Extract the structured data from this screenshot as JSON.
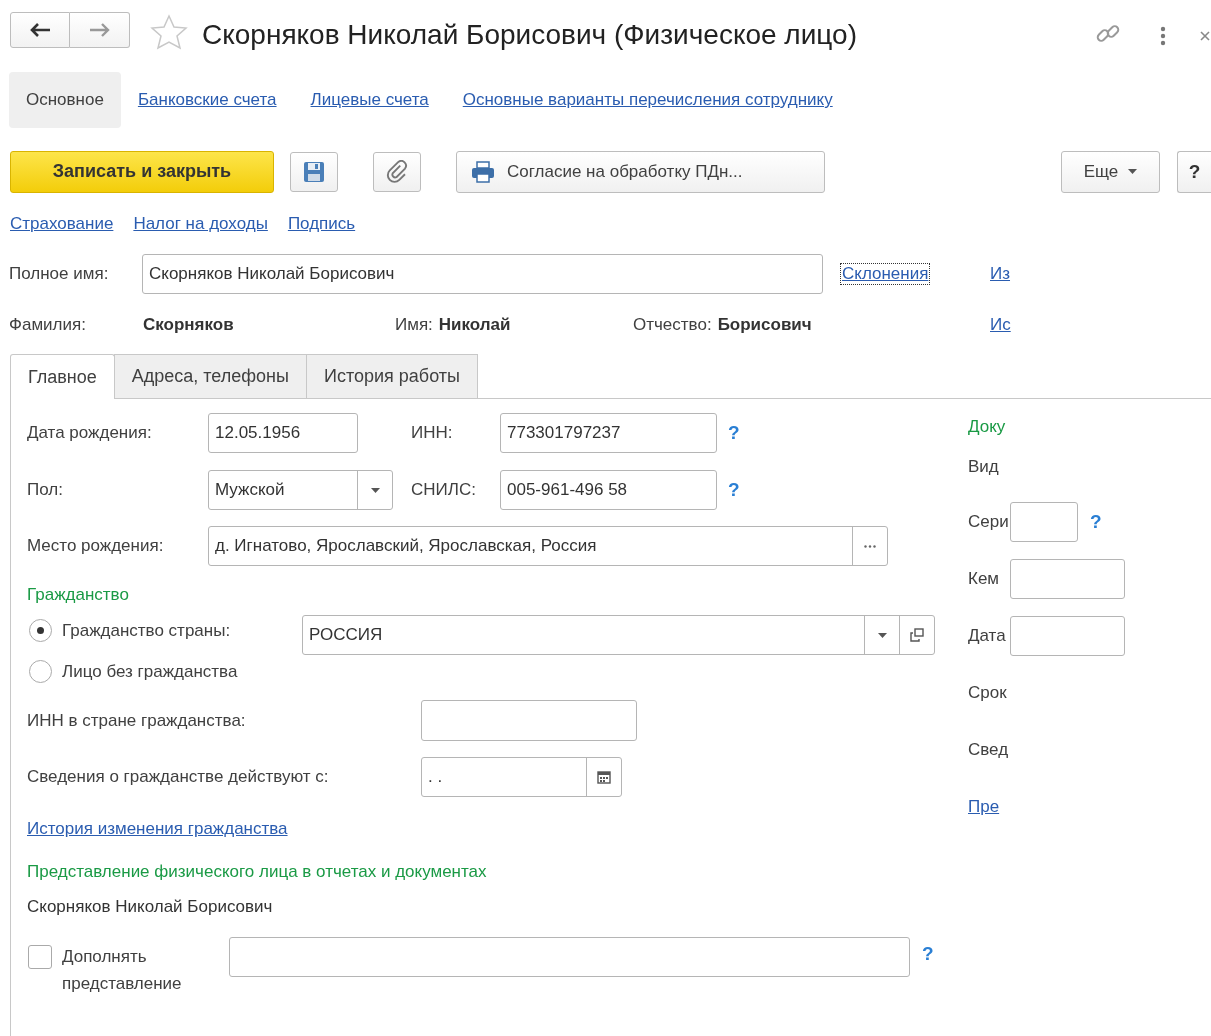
{
  "header": {
    "title": "Скорняков Николай Борисович (Физическое лицо)",
    "favorite": false
  },
  "sections": [
    {
      "label": "Основное",
      "selected": true
    },
    {
      "label": "Банковские счета",
      "selected": false
    },
    {
      "label": "Лицевые счета",
      "selected": false
    },
    {
      "label": "Основные варианты перечисления сотруднику",
      "selected": false
    }
  ],
  "toolbar": {
    "save_close": "Записать и закрыть",
    "print_consent": "Согласие на обработку ПДн...",
    "more": "Еще",
    "help": "?"
  },
  "links": [
    "Страхование",
    "Налог на доходы",
    "Подпись"
  ],
  "full_name": {
    "label": "Полное имя:",
    "value": "Скорняков Николай Борисович",
    "declensions": "Склонения"
  },
  "name_parts": [
    {
      "label": "Фамилия:",
      "value": "Скорняков"
    },
    {
      "label": "Имя:",
      "value": "Николай"
    },
    {
      "label": "Отчество:",
      "value": "Борисович"
    }
  ],
  "side_links": [
    "Из",
    "Ис"
  ],
  "tabs": [
    {
      "label": "Главное",
      "selected": true
    },
    {
      "label": "Адреса, телефоны",
      "selected": false
    },
    {
      "label": "История работы",
      "selected": false
    }
  ],
  "main": {
    "birth_date": {
      "label": "Дата рождения:",
      "value": "12.05.1956"
    },
    "inn": {
      "label": "ИНН:",
      "value": "773301797237",
      "help": "?"
    },
    "gender": {
      "label": "Пол:",
      "value": "Мужской"
    },
    "snils": {
      "label": "СНИЛС:",
      "value": "005-961-496 58",
      "help": "?"
    },
    "birth_place": {
      "label": "Место рождения:",
      "value": "д. Игнатово, Ярославский, Ярославская, Россия"
    },
    "citizenship": {
      "heading": "Гражданство",
      "options": [
        {
          "label": "Гражданство страны:",
          "selected": true
        },
        {
          "label": "Лицо без гражданства",
          "selected": false
        }
      ],
      "country": "РОССИЯ"
    },
    "foreign_inn": {
      "label": "ИНН в стране гражданства:"
    },
    "valid_from": {
      "label": "Сведения о гражданстве действуют с:",
      "value": ". ."
    },
    "history_link": "История изменения гражданства",
    "representation": {
      "heading": "Представление физического лица в отчетах и документах",
      "text": "Скорняков Николай Борисович",
      "supplement": {
        "label": "Дополнять представление",
        "checked": false
      },
      "help": "?"
    }
  },
  "document": [
    {
      "kind": "heading",
      "text": "Доку"
    },
    {
      "kind": "text",
      "text": "Вид"
    },
    {
      "kind": "field",
      "text": "Сери",
      "help": "?"
    },
    {
      "kind": "field",
      "text": "Кем"
    },
    {
      "kind": "field",
      "text": "Дата"
    },
    {
      "kind": "text",
      "text": "Срок"
    },
    {
      "kind": "text",
      "text": "Свед"
    },
    {
      "kind": "link",
      "text": "Пре"
    }
  ]
}
